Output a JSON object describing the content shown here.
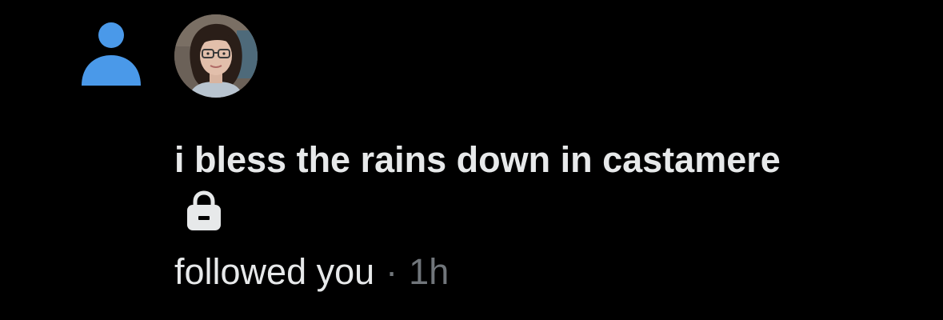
{
  "notification": {
    "type_icon": "person-icon",
    "user": {
      "display_name": "i bless the rains down in castamere",
      "protected_icon": "lock-icon",
      "avatar": "avatar-photo"
    },
    "action_text": "followed you",
    "separator": "·",
    "timestamp": "1h"
  },
  "colors": {
    "background": "#000000",
    "accent": "#4a99e9",
    "primary_text": "#e7e9ea",
    "secondary_text": "#71767b"
  }
}
